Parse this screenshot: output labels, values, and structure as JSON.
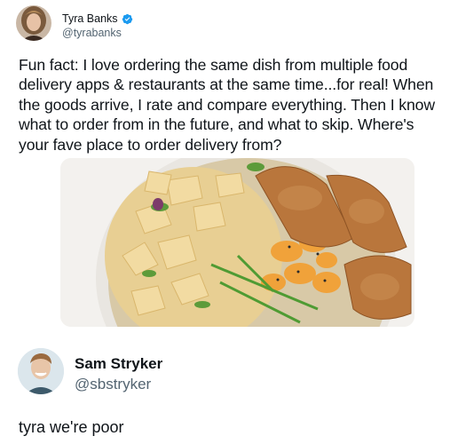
{
  "tweet1": {
    "display_name": "Tyra Banks",
    "handle": "@tyrabanks",
    "verified_color": "#1d9bf0",
    "text": "Fun fact: I love ordering the same dish from multiple food delivery apps & restaurants at the same time...for real! When the goods arrive, I rate and compare everything. Then I know what to order from in the future, and what to skip. Where's your fave place to order delivery from?"
  },
  "tweet2": {
    "display_name": "Sam Stryker",
    "handle": "@sbstryker",
    "text": "tyra we're poor"
  },
  "colors": {
    "text_primary": "#0f1419",
    "text_secondary": "#536471"
  }
}
